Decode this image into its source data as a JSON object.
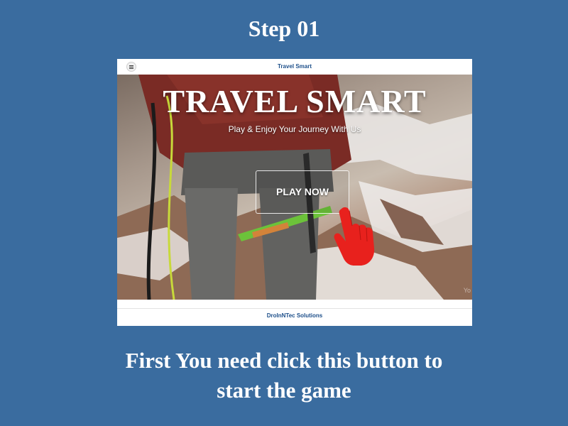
{
  "step": {
    "title": "Step 01"
  },
  "app": {
    "header_title": "Travel Smart",
    "hero_title": "TRAVEL SMART",
    "hero_subtitle": "Play & Enjoy Your Journey With Us",
    "play_button_label": "PLAY NOW",
    "watermark": "Yo",
    "footer_text": "DroInNTec Solutions",
    "icons": {
      "menu": "hamburger-menu-icon",
      "pointer": "pointing-hand-icon"
    }
  },
  "instruction": {
    "line1": "First You need click this button to",
    "line2": "start the game"
  },
  "colors": {
    "background": "#3a6c9f",
    "pointer_hand": "#e8211d",
    "header_text": "#1d4f8a"
  }
}
